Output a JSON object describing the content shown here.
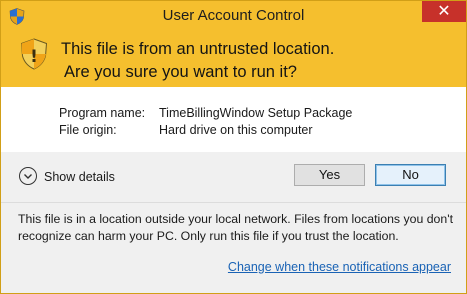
{
  "window": {
    "title": "User Account Control",
    "close_glyph": "✕"
  },
  "banner": {
    "line1": "This file is from an untrusted location.",
    "line2": "Are you sure you want to run it?",
    "icon": "uac-shield-icon"
  },
  "info": {
    "program_label": "Program name:",
    "program_value": "TimeBillingWindow Setup Package",
    "origin_label": "File origin:",
    "origin_value": "Hard drive on this computer"
  },
  "details": {
    "label": "Show details"
  },
  "buttons": {
    "yes": "Yes",
    "no": "No"
  },
  "footer": {
    "message": "This file is in a location outside your local network. Files from locations you don't recognize can harm your PC. Only run this file if you trust the location.",
    "link": "Change when these notifications appear"
  },
  "colors": {
    "banner": "#f5bf2e",
    "close_button": "#c7312a",
    "link": "#1a63b5"
  }
}
